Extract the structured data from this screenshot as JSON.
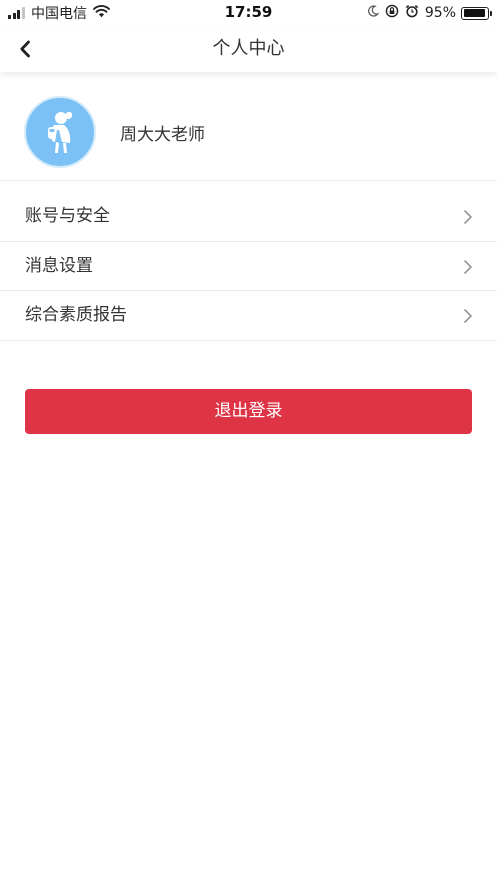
{
  "status_bar": {
    "carrier": "中国电信",
    "time": "17:59",
    "battery_percent": "95%",
    "battery_level": 0.95,
    "signal_bars_on": 3,
    "signal_bars_total": 4,
    "icons": [
      "wifi-icon",
      "moon-icon",
      "orientation-lock-icon",
      "alarm-icon",
      "battery-icon"
    ]
  },
  "nav": {
    "title": "个人中心",
    "back_icon": "chevron-left-icon"
  },
  "profile": {
    "name": "周大大老师",
    "avatar_bg": "#7cc1f6"
  },
  "menu": {
    "items": [
      {
        "label": "账号与安全"
      },
      {
        "label": "消息设置"
      },
      {
        "label": "综合素质报告"
      }
    ]
  },
  "logout": {
    "label": "退出登录",
    "color": "#de3446"
  }
}
